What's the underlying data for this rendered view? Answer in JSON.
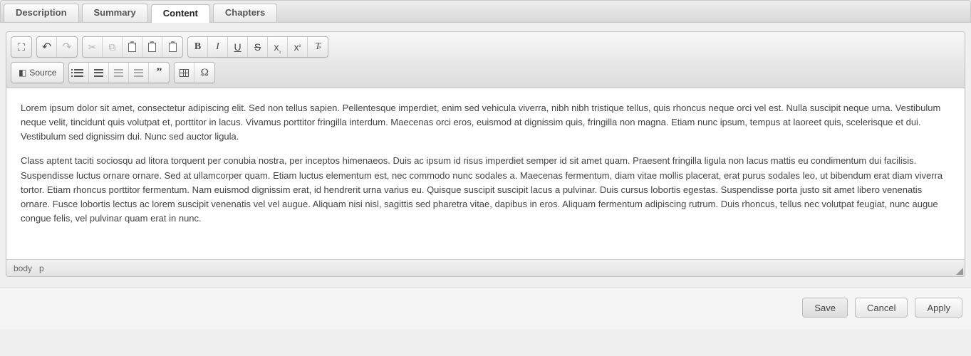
{
  "tabs": [
    {
      "label": "Description",
      "active": false
    },
    {
      "label": "Summary",
      "active": false
    },
    {
      "label": "Content",
      "active": true
    },
    {
      "label": "Chapters",
      "active": false
    }
  ],
  "toolbar": {
    "source_label": "Source"
  },
  "content": {
    "paragraph1": "Lorem ipsum dolor sit amet, consectetur adipiscing elit. Sed non tellus sapien. Pellentesque imperdiet, enim sed vehicula viverra, nibh nibh tristique tellus, quis rhoncus neque orci vel est. Nulla suscipit neque urna. Vestibulum neque velit, tincidunt quis volutpat et, porttitor in lacus. Vivamus porttitor fringilla interdum. Maecenas orci eros, euismod at dignissim quis, fringilla non magna. Etiam nunc ipsum, tempus at laoreet quis, scelerisque et dui. Vestibulum sed dignissim dui. Nunc sed auctor ligula.",
    "paragraph2": "Class aptent taciti sociosqu ad litora torquent per conubia nostra, per inceptos himenaeos. Duis ac ipsum id risus imperdiet semper id sit amet quam. Praesent fringilla ligula non lacus mattis eu condimentum dui facilisis. Suspendisse luctus ornare ornare. Sed at ullamcorper quam. Etiam luctus elementum est, nec commodo nunc sodales a. Maecenas fermentum, diam vitae mollis placerat, erat purus sodales leo, ut bibendum erat diam viverra tortor. Etiam rhoncus porttitor fermentum. Nam euismod dignissim erat, id hendrerit urna varius eu. Quisque suscipit suscipit lacus a pulvinar. Duis cursus lobortis egestas. Suspendisse porta justo sit amet libero venenatis ornare. Fusce lobortis lectus ac lorem suscipit venenatis vel vel augue. Aliquam nisi nisl, sagittis sed pharetra vitae, dapibus in eros. Aliquam fermentum adipiscing rutrum. Duis rhoncus, tellus nec volutpat feugiat, nunc augue congue felis, vel pulvinar quam erat in nunc."
  },
  "elements_path": {
    "item1": "body",
    "item2": "p"
  },
  "actions": {
    "save": "Save",
    "cancel": "Cancel",
    "apply": "Apply"
  }
}
